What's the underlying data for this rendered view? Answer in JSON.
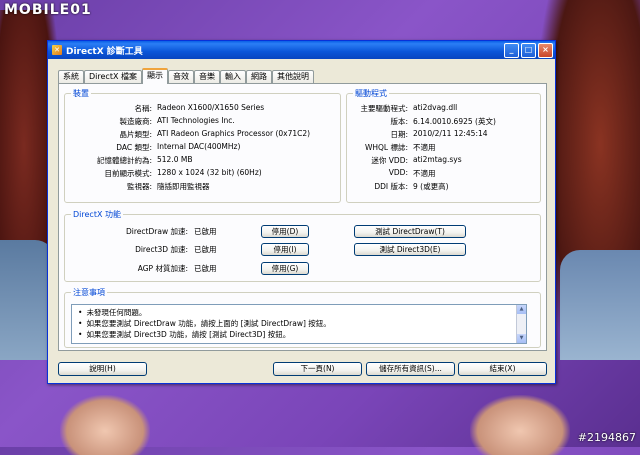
{
  "branding": {
    "logo_text": "MOBILE01",
    "watermark": "#2194867"
  },
  "window": {
    "title": "DirectX 診斷工具",
    "controls": {
      "minimize": "_",
      "maximize": "□",
      "close": "×"
    }
  },
  "tabs": [
    {
      "label": "系統"
    },
    {
      "label": "DirectX 檔案"
    },
    {
      "label": "顯示"
    },
    {
      "label": "音效"
    },
    {
      "label": "音樂"
    },
    {
      "label": "輸入"
    },
    {
      "label": "網路"
    },
    {
      "label": "其他說明"
    }
  ],
  "device": {
    "heading": "裝置",
    "rows": [
      {
        "label": "名稱:",
        "value": "Radeon X1600/X1650 Series"
      },
      {
        "label": "製造廠商:",
        "value": "ATI Technologies Inc."
      },
      {
        "label": "晶片類型:",
        "value": "ATI Radeon Graphics Processor (0x71C2)"
      },
      {
        "label": "DAC 類型:",
        "value": "Internal DAC(400MHz)"
      },
      {
        "label": "記憶體總計約為:",
        "value": "512.0 MB"
      },
      {
        "label": "目前顯示模式:",
        "value": "1280 x 1024 (32 bit) (60Hz)"
      },
      {
        "label": "監視器:",
        "value": "隨插即用監視器"
      }
    ]
  },
  "driver": {
    "heading": "驅動程式",
    "rows": [
      {
        "label": "主要驅動程式:",
        "value": "ati2dvag.dll"
      },
      {
        "label": "版本:",
        "value": "6.14.0010.6925 (英文)"
      },
      {
        "label": "日期:",
        "value": "2010/2/11 12:45:14"
      },
      {
        "label": "WHQL 標誌:",
        "value": "不適用"
      },
      {
        "label": "迷你 VDD:",
        "value": "ati2mtag.sys"
      },
      {
        "label": "VDD:",
        "value": "不適用"
      },
      {
        "label": "DDI 版本:",
        "value": "9 (或更高)"
      }
    ]
  },
  "directx_features": {
    "heading": "DirectX 功能",
    "rows": [
      {
        "label": "DirectDraw 加速:",
        "status": "已啟用",
        "disable": "停用(D)",
        "test": "測試 DirectDraw(T)"
      },
      {
        "label": "Direct3D 加速:",
        "status": "已啟用",
        "disable": "停用(I)",
        "test": "測試 Direct3D(E)"
      },
      {
        "label": "AGP 材質加速:",
        "status": "已啟用",
        "disable": "停用(G)"
      }
    ]
  },
  "notes": {
    "heading": "注意事項",
    "items": [
      "未發現任何問題。",
      "如果您要測試 DirectDraw 功能，請按上面的 [測試 DirectDraw] 按鈕。",
      "如果您要測試 Direct3D 功能，請按 [測試 Direct3D] 按鈕。"
    ]
  },
  "footer": {
    "help": "說明(H)",
    "next": "下一頁(N)",
    "save": "儲存所有資訊(S)...",
    "exit": "結束(X)"
  }
}
